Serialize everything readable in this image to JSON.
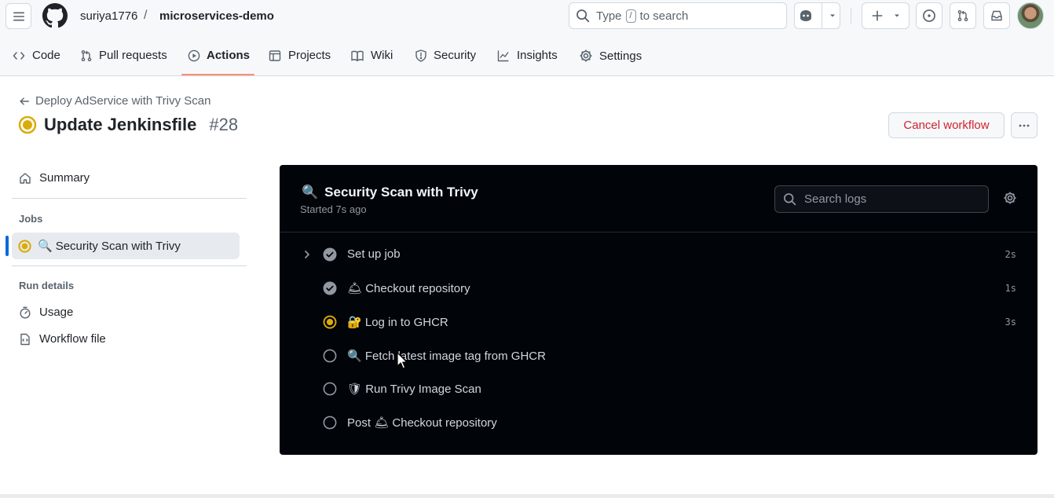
{
  "header": {
    "owner": "suriya1776",
    "separator": "/",
    "repo": "microservices-demo",
    "search": {
      "prefix": "Type",
      "key": "/",
      "suffix": "to search"
    }
  },
  "repo_nav": {
    "tabs": [
      {
        "label": "Code",
        "icon": "code-icon"
      },
      {
        "label": "Pull requests",
        "icon": "pull-request-icon"
      },
      {
        "label": "Actions",
        "icon": "play-icon",
        "active": true
      },
      {
        "label": "Projects",
        "icon": "table-icon"
      },
      {
        "label": "Wiki",
        "icon": "book-icon"
      },
      {
        "label": "Security",
        "icon": "shield-icon"
      },
      {
        "label": "Insights",
        "icon": "graph-icon"
      },
      {
        "label": "Settings",
        "icon": "gear-icon"
      }
    ]
  },
  "run": {
    "back_label": "Deploy AdService with Trivy Scan",
    "title": "Update Jenkinsfile",
    "number": "#28",
    "cancel_label": "Cancel workflow",
    "status": "in-progress"
  },
  "sidebar": {
    "summary_label": "Summary",
    "jobs_heading": "Jobs",
    "job_label": "Security Scan with Trivy",
    "job_emoji": "🔍",
    "run_details_heading": "Run details",
    "usage_label": "Usage",
    "workflow_file_label": "Workflow file"
  },
  "panel": {
    "title": "Security Scan with Trivy",
    "title_emoji": "🔍",
    "started": "Started 7s ago",
    "search_placeholder": "Search logs",
    "steps": [
      {
        "label": "Set up job",
        "emoji": "",
        "status": "success",
        "duration": "2s",
        "expandable": true
      },
      {
        "label": "Checkout repository",
        "emoji": "🛎",
        "status": "success",
        "duration": "1s"
      },
      {
        "label": "Log in to GHCR",
        "emoji": "🔐",
        "status": "in-progress",
        "duration": "3s"
      },
      {
        "label": "Fetch latest image tag from GHCR",
        "emoji": "🔍",
        "status": "pending",
        "duration": ""
      },
      {
        "label": "Run Trivy Image Scan",
        "emoji": "🛡",
        "status": "pending",
        "duration": ""
      },
      {
        "label": "Post",
        "emoji": "🛎",
        "label2": "Checkout repository",
        "status": "pending",
        "duration": ""
      }
    ]
  },
  "colors": {
    "accent_underline": "#fd8c73",
    "in_progress": "#dbab0a",
    "danger": "#cf222e",
    "panel_bg": "#010409"
  }
}
